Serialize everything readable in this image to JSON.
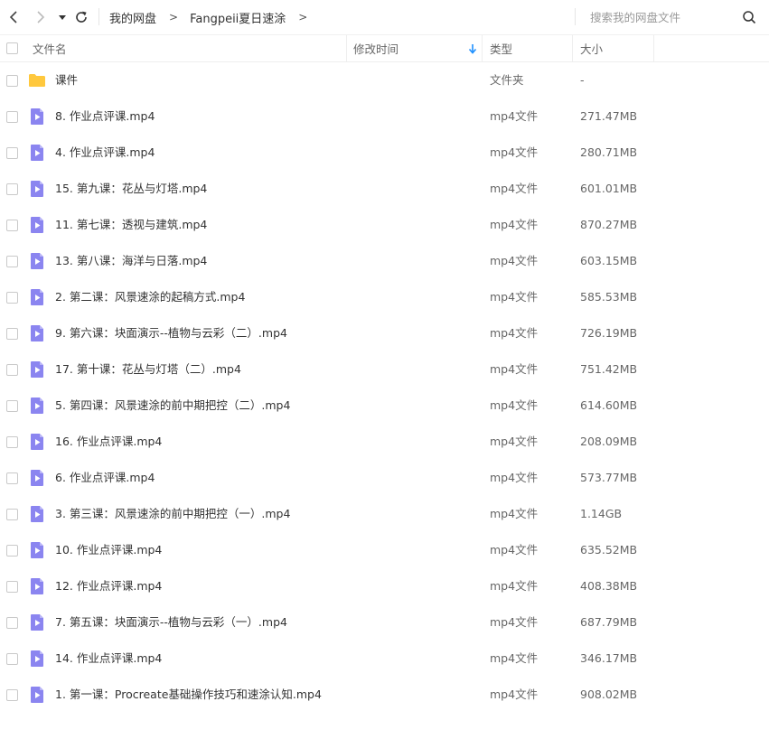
{
  "toolbar": {
    "breadcrumb": [
      "我的网盘",
      "Fangpeii夏日速涂"
    ],
    "breadcrumb_sep": ">",
    "search_placeholder": "搜索我的网盘文件"
  },
  "columns": {
    "name": "文件名",
    "modified": "修改时间",
    "type": "类型",
    "size": "大小"
  },
  "colors": {
    "folder": "#FFC83D",
    "video": "#8B85F0",
    "sort_arrow": "#1E90FF"
  },
  "files": [
    {
      "name": "课件",
      "type": "文件夹",
      "size": "-",
      "icon": "folder-icon"
    },
    {
      "name": "8. 作业点评课.mp4",
      "type": "mp4文件",
      "size": "271.47MB",
      "icon": "video-file-icon"
    },
    {
      "name": "4. 作业点评课.mp4",
      "type": "mp4文件",
      "size": "280.71MB",
      "icon": "video-file-icon"
    },
    {
      "name": "15. 第九课：花丛与灯塔.mp4",
      "type": "mp4文件",
      "size": "601.01MB",
      "icon": "video-file-icon"
    },
    {
      "name": "11. 第七课：透视与建筑.mp4",
      "type": "mp4文件",
      "size": "870.27MB",
      "icon": "video-file-icon"
    },
    {
      "name": "13. 第八课：海洋与日落.mp4",
      "type": "mp4文件",
      "size": "603.15MB",
      "icon": "video-file-icon"
    },
    {
      "name": "2. 第二课：风景速涂的起稿方式.mp4",
      "type": "mp4文件",
      "size": "585.53MB",
      "icon": "video-file-icon"
    },
    {
      "name": "9. 第六课：块面演示--植物与云彩（二）.mp4",
      "type": "mp4文件",
      "size": "726.19MB",
      "icon": "video-file-icon"
    },
    {
      "name": "17. 第十课：花丛与灯塔（二）.mp4",
      "type": "mp4文件",
      "size": "751.42MB",
      "icon": "video-file-icon"
    },
    {
      "name": "5. 第四课：风景速涂的前中期把控（二）.mp4",
      "type": "mp4文件",
      "size": "614.60MB",
      "icon": "video-file-icon"
    },
    {
      "name": "16. 作业点评课.mp4",
      "type": "mp4文件",
      "size": "208.09MB",
      "icon": "video-file-icon"
    },
    {
      "name": "6. 作业点评课.mp4",
      "type": "mp4文件",
      "size": "573.77MB",
      "icon": "video-file-icon"
    },
    {
      "name": "3. 第三课：风景速涂的前中期把控（一）.mp4",
      "type": "mp4文件",
      "size": "1.14GB",
      "icon": "video-file-icon"
    },
    {
      "name": "10. 作业点评课.mp4",
      "type": "mp4文件",
      "size": "635.52MB",
      "icon": "video-file-icon"
    },
    {
      "name": "12. 作业点评课.mp4",
      "type": "mp4文件",
      "size": "408.38MB",
      "icon": "video-file-icon"
    },
    {
      "name": "7. 第五课：块面演示--植物与云彩（一）.mp4",
      "type": "mp4文件",
      "size": "687.79MB",
      "icon": "video-file-icon"
    },
    {
      "name": "14. 作业点评课.mp4",
      "type": "mp4文件",
      "size": "346.17MB",
      "icon": "video-file-icon"
    },
    {
      "name": "1. 第一课：Procreate基础操作技巧和速涂认知.mp4",
      "type": "mp4文件",
      "size": "908.02MB",
      "icon": "video-file-icon"
    }
  ]
}
